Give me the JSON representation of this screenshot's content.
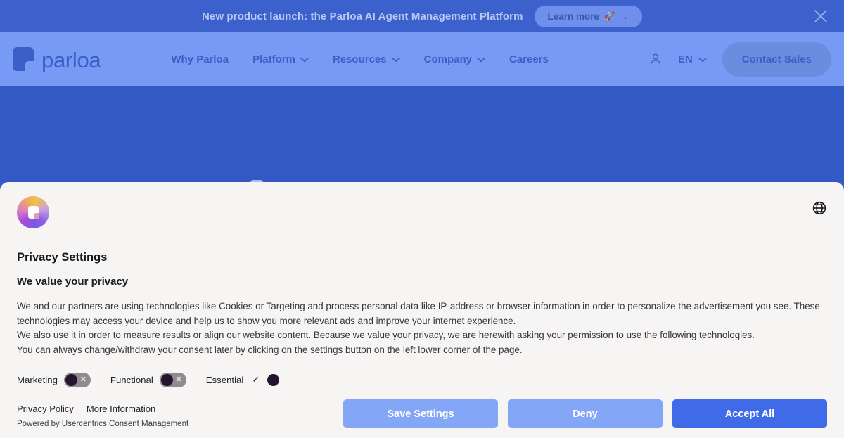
{
  "announcement": {
    "text": "New product launch: the Parloa AI Agent Management Platform",
    "cta_label": "Learn more",
    "cta_icon": "rocket",
    "cta_arrow": "→",
    "close_icon": "close-icon"
  },
  "nav": {
    "brand": "parloa",
    "links": [
      {
        "label": "Why Parloa",
        "has_dropdown": false
      },
      {
        "label": "Platform",
        "has_dropdown": true
      },
      {
        "label": "Resources",
        "has_dropdown": true
      },
      {
        "label": "Company",
        "has_dropdown": true
      },
      {
        "label": "Careers",
        "has_dropdown": false
      }
    ],
    "account_icon": "user-icon",
    "language": "EN",
    "contact_label": "Contact Sales"
  },
  "consent": {
    "brand_icon": "usercentrics-logo",
    "language_icon": "globe-icon",
    "title": "Privacy Settings",
    "subtitle": "We value your privacy",
    "body": "We and our partners are using technologies like Cookies or Targeting and process personal data like IP-address or browser information in order to personalize the advertisement you see. These technologies may access your device and help us to show you more relevant ads and improve your internet experience.\nWe also use it in order to measure results or align our website content. Because we value your privacy, we are herewith asking your permission to use the following technologies.\nYou can always change/withdraw your consent later by clicking on the settings button on the left lower corner of the page.",
    "categories": [
      {
        "label": "Marketing",
        "state": "off",
        "icon": "cross-icon"
      },
      {
        "label": "Functional",
        "state": "off",
        "icon": "cross-icon"
      },
      {
        "label": "Essential",
        "state": "locked-on",
        "icon": "check-icon"
      }
    ],
    "links": [
      {
        "label": "Privacy Policy"
      },
      {
        "label": "More Information"
      }
    ],
    "powered_by": "Powered by Usercentrics Consent Management",
    "actions": [
      {
        "label": "Save Settings",
        "style": "secondary"
      },
      {
        "label": "Deny",
        "style": "secondary"
      },
      {
        "label": "Accept All",
        "style": "primary"
      }
    ]
  },
  "colors": {
    "banner_bg": "#3c61cd",
    "nav_bg": "#779bf5",
    "hero_bg": "#3259c4",
    "dialog_bg": "#f7f4f4",
    "primary_button": "#3f6ae8",
    "secondary_button": "#84a6f6",
    "brand_blue": "#3a5fc8"
  }
}
